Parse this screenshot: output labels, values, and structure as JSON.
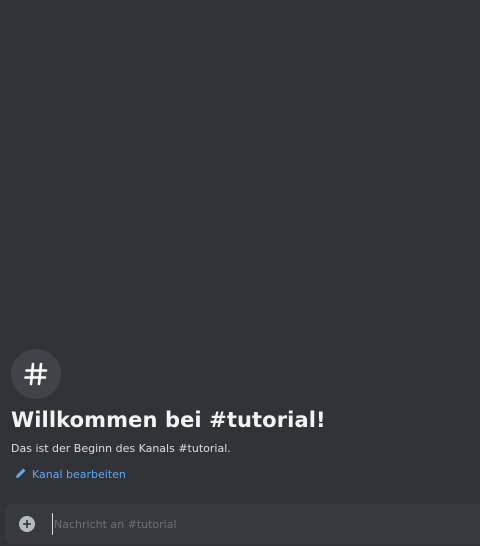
{
  "channel": {
    "name": "tutorial",
    "icon": "hash-icon"
  },
  "welcome": {
    "title": "Willkommen bei #tutorial!",
    "description": "Das ist der Beginn des Kanals #tutorial.",
    "edit_label": "Kanal bearbeiten",
    "edit_icon": "pencil-icon"
  },
  "composer": {
    "add_icon": "plus-circle-icon",
    "placeholder": "Nachricht an #tutorial",
    "value": ""
  },
  "colors": {
    "background": "#313338",
    "composer": "#383a40",
    "link": "#00a8fc"
  }
}
